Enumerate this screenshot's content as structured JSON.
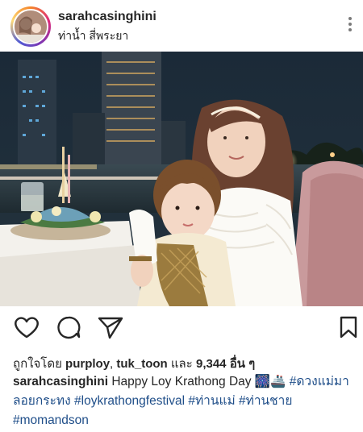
{
  "post": {
    "username": "sarahcasinghini",
    "location": "ท่าน้ำ สี่พระยา"
  },
  "likes": {
    "prefix": "ถูกใจโดย ",
    "user1": "purploy",
    "sep": ", ",
    "user2": "tuk_toon",
    "and": " และ ",
    "count": "9,344 อื่น ๆ"
  },
  "caption": {
    "username": "sarahcasinghini",
    "text": " Happy Loy Krathong Day ",
    "emojis": "🎆🚢",
    "hashtags": [
      "#ดวงแม่มาลอยกระทง",
      "#loykrathongfestival",
      "#ท่านแม่",
      "#ท่านชาย",
      "#momandson"
    ]
  },
  "icons": {
    "like": "heart-icon",
    "comment": "comment-icon",
    "share": "send-icon",
    "save": "bookmark-icon",
    "more": "more-vertical-icon"
  },
  "colors": {
    "text": "#262626",
    "hashtag": "#1f4e89",
    "ring_start": "#f58529",
    "ring_end": "#515bd4"
  }
}
